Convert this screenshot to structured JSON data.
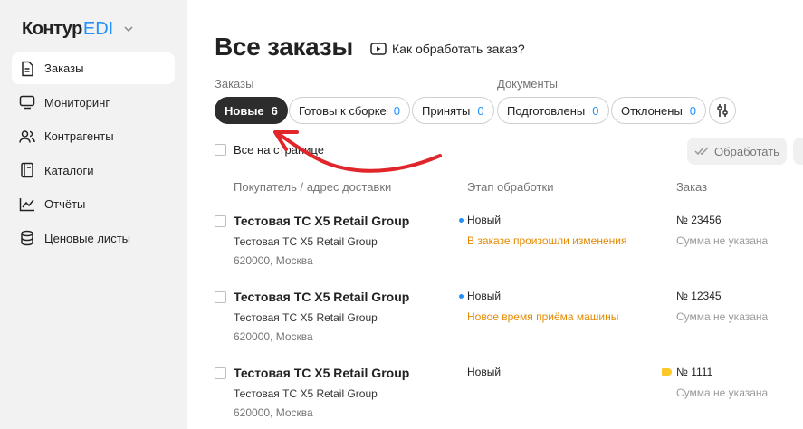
{
  "sidebar": {
    "logo": {
      "brand": "Контур",
      "product": "EDI"
    },
    "items": [
      {
        "label": "Заказы",
        "icon": "document-icon",
        "active": true
      },
      {
        "label": "Мониторинг",
        "icon": "monitor-icon",
        "active": false
      },
      {
        "label": "Контрагенты",
        "icon": "users-icon",
        "active": false
      },
      {
        "label": "Каталоги",
        "icon": "catalog-icon",
        "active": false
      },
      {
        "label": "Отчёты",
        "icon": "chart-icon",
        "active": false
      },
      {
        "label": "Ценовые листы",
        "icon": "database-icon",
        "active": false
      }
    ]
  },
  "header": {
    "title": "Все заказы",
    "howto_label": "Как обработать заказ?"
  },
  "filters": {
    "orders_group_label": "Заказы",
    "documents_group_label": "Документы",
    "orders": [
      {
        "label": "Новые",
        "count": "6",
        "active": true
      },
      {
        "label": "Готовы к сборке",
        "count": "0",
        "active": false
      },
      {
        "label": "Приняты",
        "count": "0",
        "active": false
      }
    ],
    "documents": [
      {
        "label": "Подготовлены",
        "count": "0"
      },
      {
        "label": "Отклонены",
        "count": "0"
      }
    ]
  },
  "toolbar": {
    "select_all_label": "Все на странице",
    "process_label": "Обработать"
  },
  "table": {
    "columns": [
      "Покупатель / адрес доставки",
      "Этап обработки",
      "Заказ"
    ],
    "rows": [
      {
        "buyer": "Тестовая ТС X5 Retail Group",
        "buyer_sub": "Тестовая ТС X5 Retail Group",
        "address": "620000, Москва",
        "stage": "Новый",
        "stage_note": "В заказе произошли изменения",
        "order": "№ 23456",
        "sum": "Сумма не указана"
      },
      {
        "buyer": "Тестовая ТС X5 Retail Group",
        "buyer_sub": "Тестовая ТС X5 Retail Group",
        "address": "620000, Москва",
        "stage": "Новый",
        "stage_note": "Новое время приёма машины",
        "order": "№ 12345",
        "sum": "Сумма не указана"
      },
      {
        "buyer": "Тестовая ТС X5 Retail Group",
        "buyer_sub": "Тестовая ТС X5 Retail Group",
        "address": "620000, Москва",
        "stage": "Новый",
        "stage_note": "",
        "order": "№ 1111",
        "sum": "Сумма не указана"
      }
    ]
  },
  "colors": {
    "accent": "#2291ff",
    "warning": "#e48a00",
    "annotation": "#e0262b",
    "tag": "#ffc82a"
  }
}
